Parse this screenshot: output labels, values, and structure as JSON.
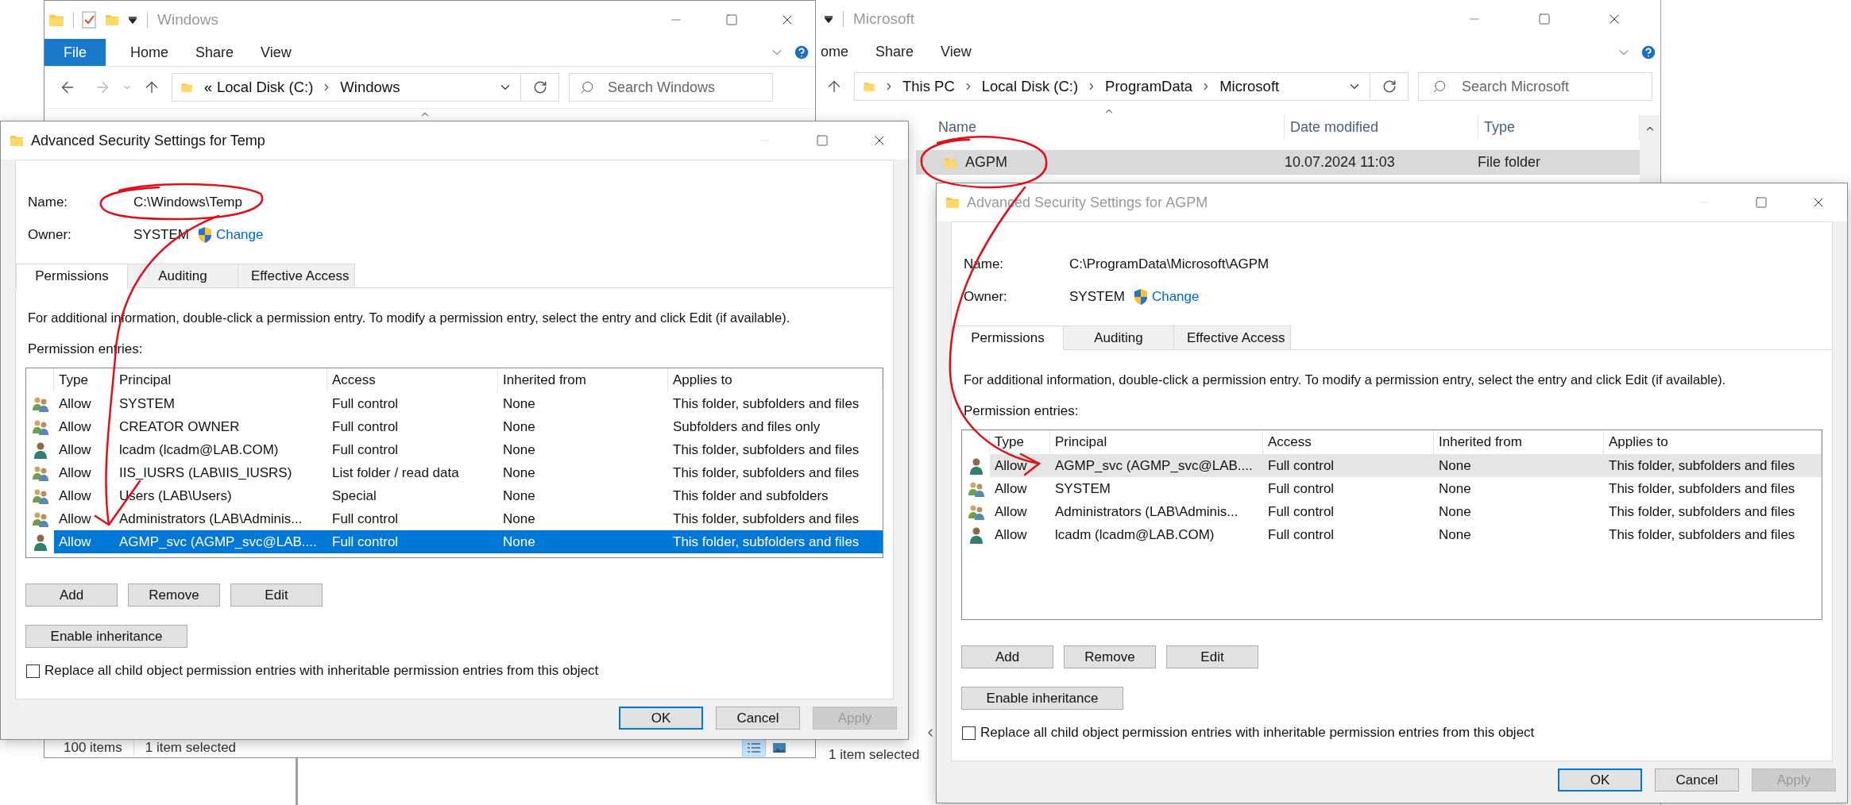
{
  "explorers": [
    {
      "title": "Windows",
      "active": false,
      "ribbon_tabs": [
        {
          "label": "File",
          "kind": "file"
        },
        {
          "label": "Home",
          "kind": "tab"
        },
        {
          "label": "Share",
          "kind": "tab"
        },
        {
          "label": "View",
          "kind": "tab"
        }
      ],
      "address": {
        "overflow": "«",
        "segments": [
          "Local Disk (C:)",
          "Windows"
        ]
      },
      "search": {
        "placeholder": "Search Windows"
      },
      "status_bar": {
        "item_count": "100 items",
        "selection": "1 item selected"
      },
      "view_buttons": [
        {
          "kind": "details",
          "selected": true
        },
        {
          "kind": "large_icons",
          "selected": false
        }
      ]
    },
    {
      "title": "Microsoft",
      "active": false,
      "ribbon_tabs": [
        {
          "label": "ome",
          "kind": "tab"
        },
        {
          "label": "Share",
          "kind": "tab"
        },
        {
          "label": "View",
          "kind": "tab"
        }
      ],
      "address": {
        "segments": [
          "This PC",
          "Local Disk (C:)",
          "ProgramData",
          "Microsoft"
        ]
      },
      "search": {
        "placeholder": "Search Microsoft"
      },
      "file_list": {
        "columns": [
          "Name",
          "Date modified",
          "Type"
        ],
        "rows": [
          {
            "name": "AGPM",
            "date_modified": "10.07.2024 11:03",
            "type": "File folder",
            "selected": true
          }
        ]
      },
      "status_bar": {
        "selection": "1 item selected"
      }
    }
  ],
  "dialogs": [
    {
      "title": "Advanced Security Settings for Temp",
      "active": true,
      "name_label": "Name:",
      "name": "C:\\Windows\\Temp",
      "owner_label": "Owner:",
      "owner": "SYSTEM",
      "change_link": "Change",
      "tabs": [
        {
          "label": "Permissions",
          "selected": true
        },
        {
          "label": "Auditing",
          "selected": false
        },
        {
          "label": "Effective Access",
          "selected": false
        }
      ],
      "info": "For additional information, double-click a permission entry. To modify a permission entry, select the entry and click Edit (if available).",
      "entries_label": "Permission entries:",
      "columns": [
        "Type",
        "Principal",
        "Access",
        "Inherited from",
        "Applies to"
      ],
      "rows": [
        {
          "kind": "group",
          "type": "Allow",
          "principal": "SYSTEM",
          "access": "Full control",
          "inherited_from": "None",
          "applies_to": "This folder, subfolders and files",
          "selected": false
        },
        {
          "kind": "group",
          "type": "Allow",
          "principal": "CREATOR OWNER",
          "access": "Full control",
          "inherited_from": "None",
          "applies_to": "Subfolders and files only",
          "selected": false
        },
        {
          "kind": "user",
          "type": "Allow",
          "principal": "lcadm (lcadm@LAB.COM)",
          "access": "Full control",
          "inherited_from": "None",
          "applies_to": "This folder, subfolders and files",
          "selected": false
        },
        {
          "kind": "group",
          "type": "Allow",
          "principal": "IIS_IUSRS (LAB\\IIS_IUSRS)",
          "access": "List folder / read data",
          "inherited_from": "None",
          "applies_to": "This folder, subfolders and files",
          "selected": false
        },
        {
          "kind": "group",
          "type": "Allow",
          "principal": "Users (LAB\\Users)",
          "access": "Special",
          "inherited_from": "None",
          "applies_to": "This folder and subfolders",
          "selected": false
        },
        {
          "kind": "group",
          "type": "Allow",
          "principal": "Administrators (LAB\\Adminis...",
          "access": "Full control",
          "inherited_from": "None",
          "applies_to": "This folder, subfolders and files",
          "selected": false
        },
        {
          "kind": "user",
          "type": "Allow",
          "principal": "AGMP_svc (AGMP_svc@LAB....",
          "access": "Full control",
          "inherited_from": "None",
          "applies_to": "This folder, subfolders and files",
          "selected": true
        }
      ],
      "buttons": [
        "Add",
        "Remove",
        "Edit"
      ],
      "inheritance_button": "Enable inheritance",
      "replace_checkbox": {
        "label": "Replace all child object permission entries with inheritable permission entries from this object",
        "checked": false
      },
      "footer_buttons": [
        {
          "label": "OK",
          "default": true,
          "disabled": false
        },
        {
          "label": "Cancel",
          "default": false,
          "disabled": false
        },
        {
          "label": "Apply",
          "default": false,
          "disabled": true
        }
      ]
    },
    {
      "title": "Advanced Security Settings for AGPM",
      "active": false,
      "name_label": "Name:",
      "name": "C:\\ProgramData\\Microsoft\\AGPM",
      "owner_label": "Owner:",
      "owner": "SYSTEM",
      "change_link": "Change",
      "tabs": [
        {
          "label": "Permissions",
          "selected": true
        },
        {
          "label": "Auditing",
          "selected": false
        },
        {
          "label": "Effective Access",
          "selected": false
        }
      ],
      "info": "For additional information, double-click a permission entry. To modify a permission entry, select the entry and click Edit (if available).",
      "entries_label": "Permission entries:",
      "columns": [
        "Type",
        "Principal",
        "Access",
        "Inherited from",
        "Applies to"
      ],
      "rows": [
        {
          "kind": "user",
          "type": "Allow",
          "principal": "AGMP_svc (AGMP_svc@LAB....",
          "access": "Full control",
          "inherited_from": "None",
          "applies_to": "This folder, subfolders and files",
          "selected": true
        },
        {
          "kind": "group",
          "type": "Allow",
          "principal": "SYSTEM",
          "access": "Full control",
          "inherited_from": "None",
          "applies_to": "This folder, subfolders and files",
          "selected": false
        },
        {
          "kind": "group",
          "type": "Allow",
          "principal": "Administrators (LAB\\Adminis...",
          "access": "Full control",
          "inherited_from": "None",
          "applies_to": "This folder, subfolders and files",
          "selected": false
        },
        {
          "kind": "user",
          "type": "Allow",
          "principal": "lcadm (lcadm@LAB.COM)",
          "access": "Full control",
          "inherited_from": "None",
          "applies_to": "This folder, subfolders and files",
          "selected": false
        }
      ],
      "buttons": [
        "Add",
        "Remove",
        "Edit"
      ],
      "inheritance_button": "Enable inheritance",
      "replace_checkbox": {
        "label": "Replace all child object permission entries with inheritable permission entries from this object",
        "checked": false
      },
      "footer_buttons": [
        {
          "label": "OK",
          "default": true,
          "disabled": false
        },
        {
          "label": "Cancel",
          "default": false,
          "disabled": false
        },
        {
          "label": "Apply",
          "default": false,
          "disabled": true
        }
      ]
    }
  ]
}
